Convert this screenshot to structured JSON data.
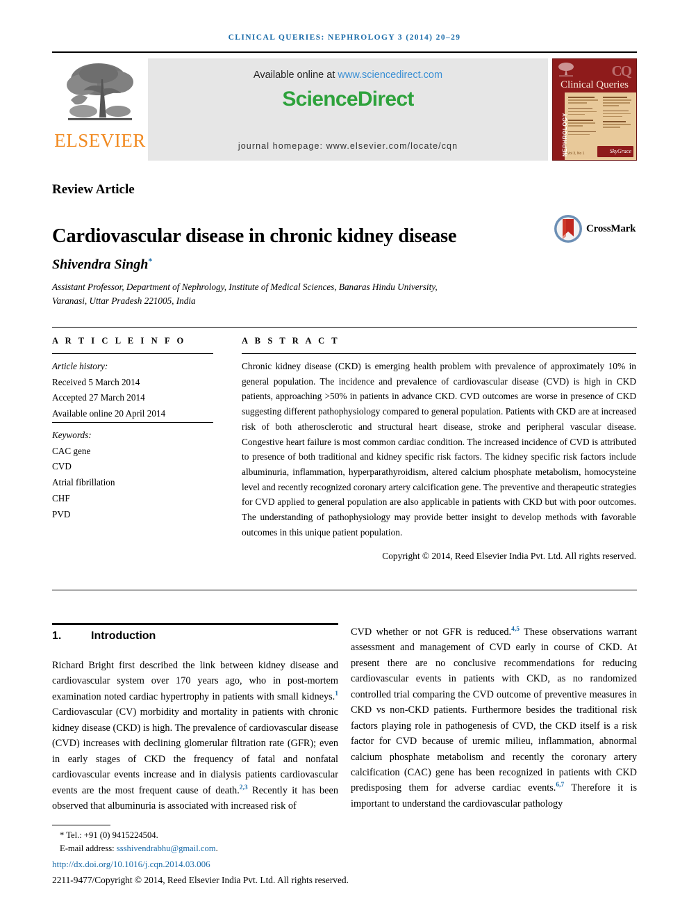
{
  "running_head": "CLINICAL QUERIES: NEPHROLOGY 3 (2014) 20–29",
  "masthead": {
    "publisher_logo_name": "elsevier-tree-logo",
    "publisher_word": "ELSEVIER",
    "available_prefix": "Available online at ",
    "available_url": "www.sciencedirect.com",
    "sciencedirect_logo": "ScienceDirect",
    "journal_homepage": "journal homepage: www.elsevier.com/locate/cqn",
    "cover": {
      "title": "Clinical Queries",
      "monogram": "CQ",
      "spine": "NEPHROLOGY",
      "imprint": "SkyGrace",
      "issue_line": "Vol 3, No 1"
    },
    "colors": {
      "sciencedirect_green": "#2EA23C",
      "elsevier_orange": "#F18A21",
      "link_blue": "#3a8fd4",
      "cover_maroon": "#8E1B1B",
      "cover_panel": "#E8C99A"
    }
  },
  "article": {
    "type": "Review Article",
    "title": "Cardiovascular disease in chronic kidney disease",
    "crossmark_label": "CrossMark",
    "author": "Shivendra Singh",
    "author_marker": "*",
    "affiliation_line1": "Assistant Professor, Department of Nephrology, Institute of Medical Sciences, Banaras Hindu University,",
    "affiliation_line2": "Varanasi, Uttar Pradesh 221005, India"
  },
  "info": {
    "heading": "A R T I C L E   I N F O",
    "history_label": "Article history:",
    "history": [
      "Received 5 March 2014",
      "Accepted 27 March 2014",
      "Available online 20 April 2014"
    ],
    "keywords_label": "Keywords:",
    "keywords": [
      "CAC gene",
      "CVD",
      "Atrial fibrillation",
      "CHF",
      "PVD"
    ]
  },
  "abstract": {
    "heading": "A B S T R A C T",
    "text": "Chronic kidney disease (CKD) is emerging health problem with prevalence of approximately 10% in general population. The incidence and prevalence of cardiovascular disease (CVD) is high in CKD patients, approaching >50% in patients in advance CKD. CVD outcomes are worse in presence of CKD suggesting different pathophysiology compared to general population. Patients with CKD are at increased risk of both atherosclerotic and structural heart disease, stroke and peripheral vascular disease. Congestive heart failure is most common cardiac condition. The increased incidence of CVD is attributed to presence of both traditional and kidney specific risk factors. The kidney specific risk factors include albuminuria, inflammation, hyperparathyroidism, altered calcium phosphate metabolism, homocysteine level and recently recognized coronary artery calcification gene. The preventive and therapeutic strategies for CVD applied to general population are also applicable in patients with CKD but with poor outcomes. The understanding of pathophysiology may provide better insight to develop methods with favorable outcomes in this unique patient population.",
    "copyright": "Copyright © 2014, Reed Elsevier India Pvt. Ltd. All rights reserved."
  },
  "body": {
    "section_number": "1.",
    "section_title": "Introduction",
    "left_column_html": "Richard Bright first described the link between kidney disease and cardiovascular system over 170 years ago, who in post-mortem examination noted cardiac hypertrophy in patients with small kidneys.<sup>1</sup> Cardiovascular (CV) morbidity and mortality in patients with chronic kidney disease (CKD) is high. The prevalence of cardiovascular disease (CVD) increases with declining glomerular filtration rate (GFR); even in early stages of CKD the frequency of fatal and nonfatal cardiovascular events increase and in dialysis patients cardiovascular events are the most frequent cause of death.<sup>2,3</sup> Recently it has been observed that albuminuria is associated with increased risk of",
    "right_column_html": "CVD whether or not GFR is reduced.<sup>4,5</sup> These observations warrant assessment and management of CVD early in course of CKD. At present there are no conclusive recommendations for reducing cardiovascular events in patients with CKD, as no randomized controlled trial comparing the CVD outcome of preventive measures in CKD vs non-CKD patients. Furthermore besides the traditional risk factors playing role in pathogenesis of CVD, the CKD itself is a risk factor for CVD because of uremic milieu, inflammation, abnormal calcium phosphate metabolism and recently the coronary artery calcification (CAC) gene has been recognized in patients with CKD predisposing them for adverse cardiac events.<sup>6,7</sup> Therefore it is important to understand the cardiovascular pathology"
  },
  "footer": {
    "tel": "Tel.: +91 (0) 9415224504.",
    "email_label": "E-mail address:",
    "email": "ssshivendrabhu@gmail.com",
    "doi": "http://dx.doi.org/10.1016/j.cqn.2014.03.006",
    "issn_copyright": "2211-9477/Copyright © 2014, Reed Elsevier India Pvt. Ltd. All rights reserved."
  }
}
